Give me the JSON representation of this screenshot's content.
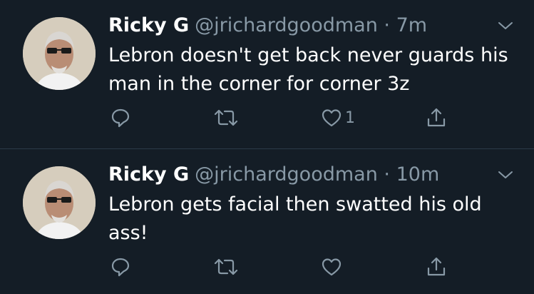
{
  "tweets": [
    {
      "name": "Ricky G",
      "handle": "@jrichardgoodman",
      "separator": "·",
      "time": "7m",
      "text": "Lebron doesn't get back never guards his man in the corner for corner 3z",
      "like_count": "1"
    },
    {
      "name": "Ricky G",
      "handle": "@jrichardgoodman",
      "separator": "·",
      "time": "10m",
      "text": "Lebron gets facial then swatted his old ass!",
      "like_count": ""
    }
  ],
  "icons": {
    "reply": "reply-icon",
    "retweet": "retweet-icon",
    "like": "heart-icon",
    "share": "share-icon",
    "menu": "chevron-down-icon"
  },
  "colors": {
    "background": "#141d26",
    "secondary_text": "#8899a6",
    "divider": "#2b3a48"
  }
}
